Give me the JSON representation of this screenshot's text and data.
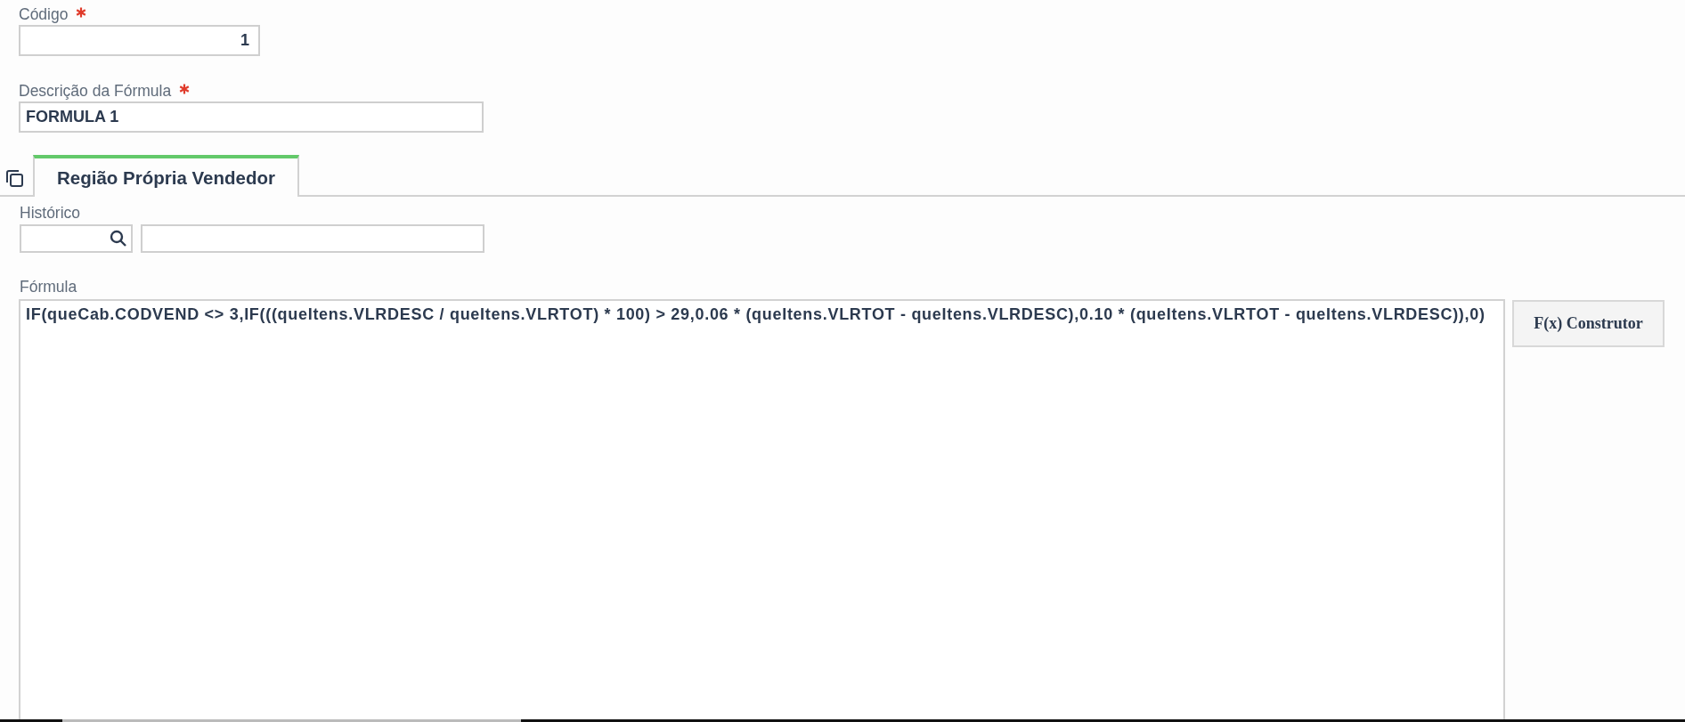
{
  "fields": [
    {
      "label": "Código",
      "required": true,
      "value": "1",
      "kind": "number"
    },
    {
      "label": "Descrição da Fórmula",
      "required": true,
      "value": "FORMULA 1",
      "kind": "text"
    }
  ],
  "tabs": [
    {
      "label": "Região Própria Vendedor",
      "selected": true
    }
  ],
  "historico": {
    "label": "Histórico"
  },
  "formula": {
    "label": "Fórmula",
    "value": "IF(queCab.CODVEND <> 3,IF(((queItens.VLRDESC / queItens.VLRTOT) * 100) > 29,0.06 * (queItens.VLRTOT - queItens.VLRDESC),0.10 * (queItens.VLRTOT - queItens.VLRDESC)),0)",
    "button": "F(x) Construtor"
  }
}
